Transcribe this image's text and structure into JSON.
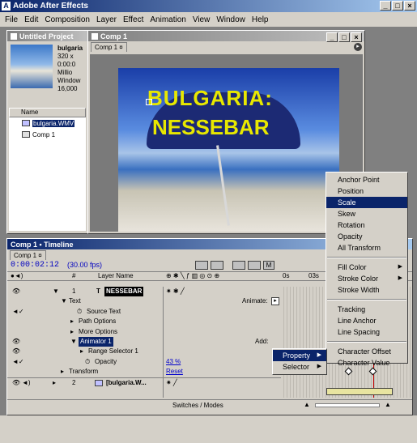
{
  "window": {
    "title": "Adobe After Effects"
  },
  "menu": [
    "File",
    "Edit",
    "Composition",
    "Layer",
    "Effect",
    "Animation",
    "View",
    "Window",
    "Help"
  ],
  "project": {
    "title": "Untitled Project",
    "thumb_name": "bulgaria",
    "info_lines": [
      "320 x",
      "0:00:0",
      "Millio",
      "Window",
      "16,000"
    ],
    "col_name": "Name",
    "items": [
      "bulgaria.WMV",
      "Comp 1"
    ]
  },
  "comp": {
    "title": "Comp 1",
    "tab": "Comp 1",
    "text_line1": "BULGARIA:",
    "text_line2": "NESSEBAR"
  },
  "context_menu": {
    "items": [
      {
        "label": "Anchor Point"
      },
      {
        "label": "Position"
      },
      {
        "label": "Scale",
        "highlighted": true
      },
      {
        "label": "Skew"
      },
      {
        "label": "Rotation"
      },
      {
        "label": "Opacity"
      },
      {
        "label": "All Transform"
      },
      {
        "sep": true
      },
      {
        "label": "Fill Color",
        "submenu": true
      },
      {
        "label": "Stroke Color",
        "submenu": true
      },
      {
        "label": "Stroke Width"
      },
      {
        "sep": true
      },
      {
        "label": "Tracking"
      },
      {
        "label": "Line Anchor"
      },
      {
        "label": "Line Spacing"
      },
      {
        "sep": true
      },
      {
        "label": "Character Offset"
      },
      {
        "label": "Character Value"
      }
    ]
  },
  "sub_menu": {
    "items": [
      "Property",
      "Selector"
    ]
  },
  "timeline": {
    "title": "Comp 1 • Timeline",
    "tab": "Comp 1",
    "timecode": "0:00:02:12",
    "fps": "(30.00 fps)",
    "col_num": "#",
    "col_layer_name": "Layer Name",
    "ruler": [
      "0s",
      "03s"
    ],
    "layer1_num": "1",
    "layer1_name": "NESSEBAR",
    "text_label": "Text",
    "animate_label": "Animate:",
    "source_text": "Source Text",
    "path_options": "Path Options",
    "more_options": "More Options",
    "animator": "Animator 1",
    "add_label": "Add:",
    "range_selector": "Range Selector 1",
    "opacity_label": "Opacity",
    "opacity_value": "43 %",
    "transform_label": "Transform",
    "reset_label": "Reset",
    "layer2_num": "2",
    "layer2_name": "[bulgaria.W...",
    "switches_modes": "Switches / Modes"
  },
  "colors": {
    "accent": "#0a246a",
    "timecode": "#0000c0",
    "comp_text": "#e8e800",
    "value_blue": "#0000cc"
  }
}
